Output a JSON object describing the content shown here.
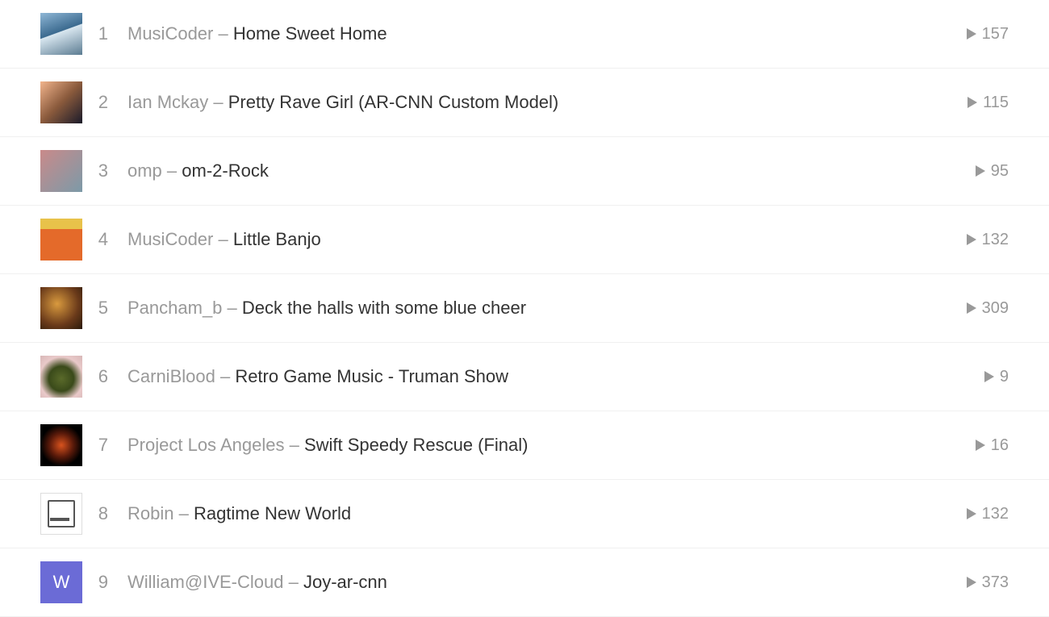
{
  "tracks": [
    {
      "rank": "1",
      "artist": "MusiCoder",
      "title": "Home Sweet Home",
      "plays": "157",
      "thumb_class": "th-1",
      "thumb_letter": ""
    },
    {
      "rank": "2",
      "artist": "Ian Mckay",
      "title": "Pretty Rave Girl (AR-CNN Custom Model)",
      "plays": "115",
      "thumb_class": "th-2",
      "thumb_letter": ""
    },
    {
      "rank": "3",
      "artist": "omp",
      "title": "om-2-Rock",
      "plays": "95",
      "thumb_class": "th-3",
      "thumb_letter": ""
    },
    {
      "rank": "4",
      "artist": "MusiCoder",
      "title": "Little Banjo",
      "plays": "132",
      "thumb_class": "th-4",
      "thumb_letter": ""
    },
    {
      "rank": "5",
      "artist": "Pancham_b",
      "title": "Deck the halls with some blue cheer",
      "plays": "309",
      "thumb_class": "th-5",
      "thumb_letter": ""
    },
    {
      "rank": "6",
      "artist": "CarniBlood",
      "title": "Retro Game Music - Truman Show",
      "plays": "9",
      "thumb_class": "th-6",
      "thumb_letter": ""
    },
    {
      "rank": "7",
      "artist": "Project Los Angeles",
      "title": "Swift Speedy Rescue (Final)",
      "plays": "16",
      "thumb_class": "th-7",
      "thumb_letter": ""
    },
    {
      "rank": "8",
      "artist": "Robin",
      "title": "Ragtime New World",
      "plays": "132",
      "thumb_class": "th-8",
      "thumb_letter": ""
    },
    {
      "rank": "9",
      "artist": "William@IVE-Cloud",
      "title": "Joy-ar-cnn",
      "plays": "373",
      "thumb_class": "th-9",
      "thumb_letter": "W"
    }
  ],
  "separator": " – "
}
